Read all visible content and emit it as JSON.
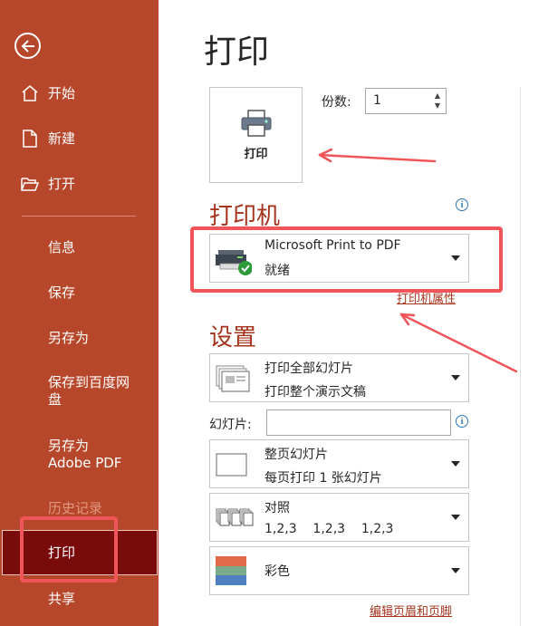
{
  "sidebar": {
    "back_icon": "arrow-left-circle-icon",
    "items": [
      {
        "label": "开始",
        "icon": "home-icon"
      },
      {
        "label": "新建",
        "icon": "new-file-icon"
      },
      {
        "label": "打开",
        "icon": "folder-open-icon"
      },
      {
        "label": "信息"
      },
      {
        "label": "保存"
      },
      {
        "label": "另存为"
      },
      {
        "label": "保存到百度网\n盘"
      },
      {
        "label": "另存为\nAdobe PDF"
      },
      {
        "label": "历史记录"
      },
      {
        "label": "打印"
      },
      {
        "label": "共享"
      }
    ]
  },
  "main": {
    "title": "打印",
    "print_button_label": "打印",
    "copies_label": "份数:",
    "copies_value": "1",
    "printer_heading": "打印机",
    "printer": {
      "name": "Microsoft Print to PDF",
      "status": "就绪"
    },
    "printer_properties_link": "打印机属性",
    "settings_heading": "设置",
    "settings": {
      "range": {
        "line1": "打印全部幻灯片",
        "line2": "打印整个演示文稿"
      },
      "slides_label": "幻灯片:",
      "slides_value": "",
      "layout": {
        "line1": "整页幻灯片",
        "line2": "每页打印 1 张幻灯片"
      },
      "collate": {
        "line1": "对照",
        "line2": "1,2,3    1,2,3    1,2,3"
      },
      "color": {
        "line1": "彩色"
      }
    },
    "edit_header_footer_link": "编辑页眉和页脚"
  },
  "colors": {
    "sidebar_bg": "#b7472a",
    "active_bg": "#7a0b0b",
    "accent": "#a5341d",
    "annotation_red": "#f0555a",
    "info_blue": "#2e75b6"
  }
}
